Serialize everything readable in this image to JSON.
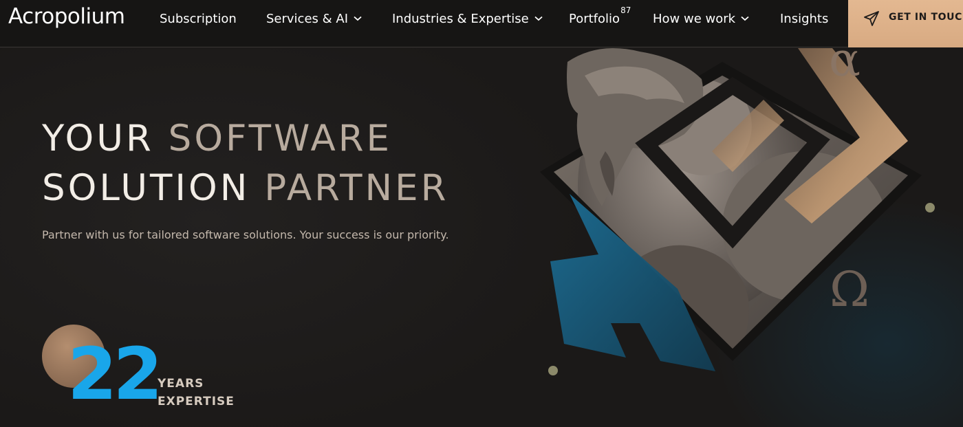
{
  "header": {
    "logo": "Acropolium",
    "nav": [
      {
        "label": "Subscription",
        "dropdown": false
      },
      {
        "label": "Services & AI",
        "dropdown": true
      },
      {
        "label": "Industries & Expertise",
        "dropdown": true
      },
      {
        "label": "Portfolio",
        "badge": "87",
        "dropdown": false
      },
      {
        "label": "How we work",
        "dropdown": true
      },
      {
        "label": "Insights",
        "dropdown": false
      }
    ],
    "cta": {
      "label": "GET IN TOUCH",
      "icon": "paper-plane-icon"
    }
  },
  "hero": {
    "headline_line1": {
      "a": "YOUR",
      "b": "SOFTWARE"
    },
    "headline_line2": {
      "a": "SOLUTION",
      "b": "PARTNER"
    },
    "subtitle": "Partner with us for tailored software solutions. Your success is our priority.",
    "years": {
      "number": "22",
      "line1": "YEARS",
      "line2": "EXPERTISE"
    },
    "art": {
      "alpha_glyph": "α",
      "omega_glyph": "Ω"
    }
  },
  "colors": {
    "background": "#1c1a19",
    "accent_gold": "#d8aa82",
    "accent_blue": "#19a6ea",
    "teal_shape": "#1a5a78"
  }
}
